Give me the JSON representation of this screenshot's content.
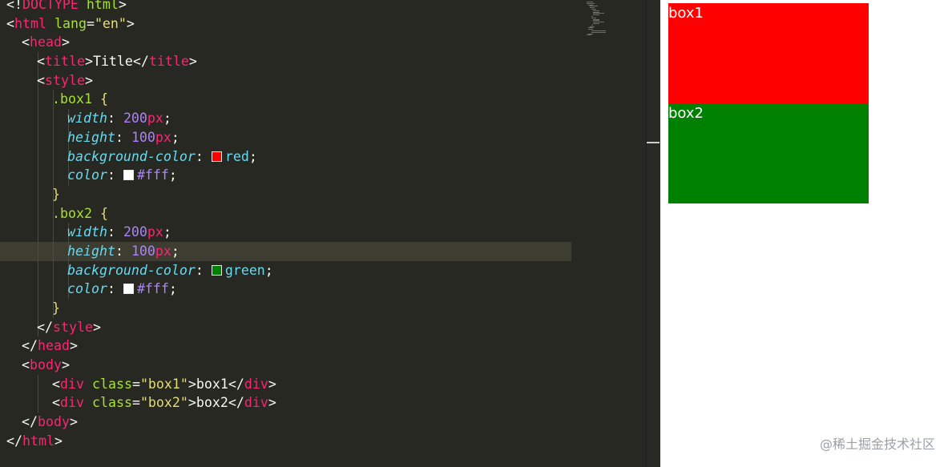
{
  "editor": {
    "lines": [
      {
        "indent": 0,
        "guides": [],
        "tokens": [
          [
            "t-punct",
            "<!"
          ],
          [
            "t-doctype",
            "DOCTYPE"
          ],
          [
            "t-punct",
            " "
          ],
          [
            "t-attr",
            "html"
          ],
          [
            "t-punct",
            ">"
          ]
        ]
      },
      {
        "indent": 0,
        "guides": [],
        "tokens": [
          [
            "t-punct",
            "<"
          ],
          [
            "t-tag",
            "html"
          ],
          [
            "t-punct",
            " "
          ],
          [
            "t-attr",
            "lang"
          ],
          [
            "t-punct",
            "="
          ],
          [
            "t-str",
            "\"en\""
          ],
          [
            "t-punct",
            ">"
          ]
        ]
      },
      {
        "indent": 1,
        "guides": [],
        "tokens": [
          [
            "t-punct",
            "<"
          ],
          [
            "t-tag",
            "head"
          ],
          [
            "t-punct",
            ">"
          ]
        ]
      },
      {
        "indent": 2,
        "guides": [
          1
        ],
        "tokens": [
          [
            "t-punct",
            "<"
          ],
          [
            "t-tag",
            "title"
          ],
          [
            "t-punct",
            ">"
          ],
          [
            "t-text",
            "Title"
          ],
          [
            "t-punct",
            "</"
          ],
          [
            "t-tag",
            "title"
          ],
          [
            "t-punct",
            ">"
          ]
        ]
      },
      {
        "indent": 2,
        "guides": [
          1
        ],
        "tokens": [
          [
            "t-punct",
            "<"
          ],
          [
            "t-tag",
            "style"
          ],
          [
            "t-punct",
            ">"
          ]
        ]
      },
      {
        "indent": 3,
        "guides": [
          1,
          2
        ],
        "tokens": [
          [
            "t-sel",
            ".box1"
          ],
          [
            "t-punct",
            " "
          ],
          [
            "t-brace",
            "{"
          ]
        ]
      },
      {
        "indent": 4,
        "guides": [
          1,
          2,
          3
        ],
        "tokens": [
          [
            "t-prop",
            "width"
          ],
          [
            "t-punct",
            ": "
          ],
          [
            "t-num",
            "200"
          ],
          [
            "t-unit",
            "px"
          ],
          [
            "t-punct",
            ";"
          ]
        ]
      },
      {
        "indent": 4,
        "guides": [
          1,
          2,
          3
        ],
        "tokens": [
          [
            "t-prop",
            "height"
          ],
          [
            "t-punct",
            ": "
          ],
          [
            "t-num",
            "100"
          ],
          [
            "t-unit",
            "px"
          ],
          [
            "t-punct",
            ";"
          ]
        ]
      },
      {
        "indent": 4,
        "guides": [
          1,
          2,
          3
        ],
        "tokens": [
          [
            "t-prop",
            "background-color"
          ],
          [
            "t-punct",
            ": "
          ],
          [
            "swatch",
            "#ff0000"
          ],
          [
            "t-kw",
            "red"
          ],
          [
            "t-punct",
            ";"
          ]
        ]
      },
      {
        "indent": 4,
        "guides": [
          1,
          2,
          3
        ],
        "tokens": [
          [
            "t-prop",
            "color"
          ],
          [
            "t-punct",
            ": "
          ],
          [
            "swatch",
            "#ffffff"
          ],
          [
            "t-hex",
            "#fff"
          ],
          [
            "t-punct",
            ";"
          ]
        ]
      },
      {
        "indent": 3,
        "guides": [
          1,
          2
        ],
        "tokens": [
          [
            "t-brace",
            "}"
          ]
        ]
      },
      {
        "indent": 3,
        "guides": [
          1,
          2
        ],
        "tokens": [
          [
            "t-sel",
            ".box2"
          ],
          [
            "t-punct",
            " "
          ],
          [
            "t-brace",
            "{"
          ]
        ]
      },
      {
        "indent": 4,
        "guides": [
          1,
          2,
          3
        ],
        "tokens": [
          [
            "t-prop",
            "width"
          ],
          [
            "t-punct",
            ": "
          ],
          [
            "t-num",
            "200"
          ],
          [
            "t-unit",
            "px"
          ],
          [
            "t-punct",
            ";"
          ]
        ]
      },
      {
        "indent": 4,
        "guides": [
          1,
          2,
          3
        ],
        "active": true,
        "tokens": [
          [
            "t-prop",
            "height"
          ],
          [
            "t-punct",
            ": "
          ],
          [
            "t-num",
            "100"
          ],
          [
            "t-unit",
            "px"
          ],
          [
            "t-punct",
            ";"
          ]
        ]
      },
      {
        "indent": 4,
        "guides": [
          1,
          2,
          3
        ],
        "tokens": [
          [
            "t-prop",
            "background-color"
          ],
          [
            "t-punct",
            ": "
          ],
          [
            "swatch",
            "#008000"
          ],
          [
            "t-kw",
            "green"
          ],
          [
            "t-punct",
            ";"
          ]
        ]
      },
      {
        "indent": 4,
        "guides": [
          1,
          2,
          3
        ],
        "tokens": [
          [
            "t-prop",
            "color"
          ],
          [
            "t-punct",
            ": "
          ],
          [
            "swatch",
            "#ffffff"
          ],
          [
            "t-hex",
            "#fff"
          ],
          [
            "t-punct",
            ";"
          ]
        ]
      },
      {
        "indent": 3,
        "guides": [
          1,
          2
        ],
        "tokens": [
          [
            "t-brace",
            "}"
          ]
        ]
      },
      {
        "indent": 2,
        "guides": [
          1
        ],
        "tokens": [
          [
            "t-punct",
            "</"
          ],
          [
            "t-tag",
            "style"
          ],
          [
            "t-punct",
            ">"
          ]
        ]
      },
      {
        "indent": 1,
        "guides": [],
        "tokens": [
          [
            "t-punct",
            "</"
          ],
          [
            "t-tag",
            "head"
          ],
          [
            "t-punct",
            ">"
          ]
        ]
      },
      {
        "indent": 1,
        "guides": [],
        "tokens": [
          [
            "t-punct",
            "<"
          ],
          [
            "t-tag",
            "body"
          ],
          [
            "t-punct",
            ">"
          ]
        ]
      },
      {
        "indent": 3,
        "guides": [
          1
        ],
        "tokens": [
          [
            "t-punct",
            "<"
          ],
          [
            "t-tag",
            "div"
          ],
          [
            "t-punct",
            " "
          ],
          [
            "t-attr",
            "class"
          ],
          [
            "t-punct",
            "="
          ],
          [
            "t-str",
            "\"box1\""
          ],
          [
            "t-punct",
            ">"
          ],
          [
            "t-text",
            "box1"
          ],
          [
            "t-punct",
            "</"
          ],
          [
            "t-tag",
            "div"
          ],
          [
            "t-punct",
            ">"
          ]
        ]
      },
      {
        "indent": 3,
        "guides": [
          1
        ],
        "tokens": [
          [
            "t-punct",
            "<"
          ],
          [
            "t-tag",
            "div"
          ],
          [
            "t-punct",
            " "
          ],
          [
            "t-attr",
            "class"
          ],
          [
            "t-punct",
            "="
          ],
          [
            "t-str",
            "\"box2\""
          ],
          [
            "t-punct",
            ">"
          ],
          [
            "t-text",
            "box2"
          ],
          [
            "t-punct",
            "</"
          ],
          [
            "t-tag",
            "div"
          ],
          [
            "t-punct",
            ">"
          ]
        ]
      },
      {
        "indent": 1,
        "guides": [],
        "tokens": [
          [
            "t-punct",
            "</"
          ],
          [
            "t-tag",
            "body"
          ],
          [
            "t-punct",
            ">"
          ]
        ]
      },
      {
        "indent": 0,
        "guides": [],
        "tokens": [
          [
            "t-punct",
            "</"
          ],
          [
            "t-tag",
            "html"
          ],
          [
            "t-punct",
            ">"
          ]
        ]
      }
    ]
  },
  "preview": {
    "box1": {
      "label": "box1",
      "background": "#ff0000",
      "color": "#ffffff"
    },
    "box2": {
      "label": "box2",
      "background": "#008000",
      "color": "#ffffff"
    }
  },
  "watermark": "@稀土掘金技术社区"
}
